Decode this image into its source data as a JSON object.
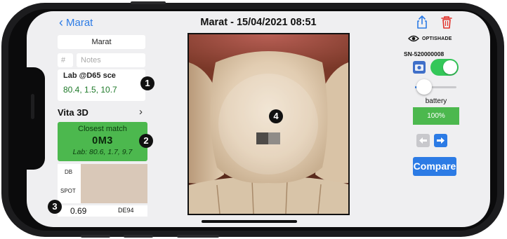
{
  "nav": {
    "back_label": "Marat",
    "title": "Marat - 15/04/2021 08:51",
    "share_icon": "share-icon",
    "trash_icon": "trash-icon",
    "accent": "#2c7be5",
    "delete_color": "#e2332c"
  },
  "left": {
    "name_value": "Marat",
    "number_placeholder": "#",
    "notes_placeholder": "Notes",
    "lab_title": "Lab @D65 sce",
    "lab_values": "80.4, 1.5, 10.7",
    "badge_1": "1",
    "vita_label": "Vita 3D",
    "vita_chevron": "›",
    "match_title": "Closest match",
    "match_code": "0M3",
    "match_lab": "Lab: 80.6, 1.7, 9.7",
    "badge_2": "2",
    "db_label": "DB",
    "spot_label": "SPOT",
    "swatch_color": "#d9c8b8",
    "de_value": "0.69",
    "de_label": "DE94",
    "badge_3": "3",
    "match_color": "#4cb84e"
  },
  "photo": {
    "badge_4": "4"
  },
  "right": {
    "brand": "OPTISHADE",
    "eye_icon": "eye-icon",
    "serial": "SN-520000008",
    "camera_icon": "camera-icon",
    "toggle_on": true,
    "slider_level": 0.08,
    "battery_label": "battery",
    "battery_value": "100%",
    "prev_icon": "arrow-left-icon",
    "next_icon": "arrow-right-icon",
    "compare_label": "Compare"
  }
}
